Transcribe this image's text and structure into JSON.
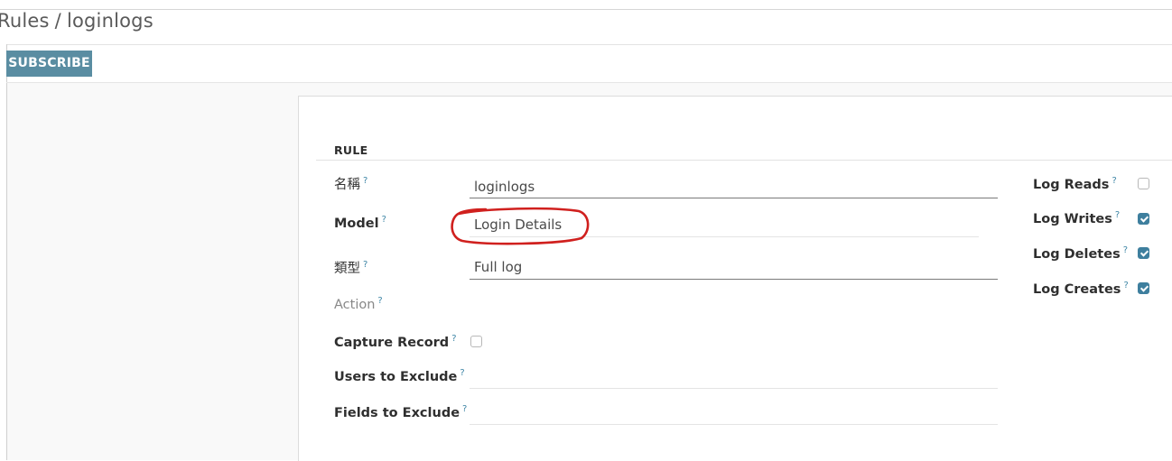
{
  "breadcrumb": {
    "parent": "Rules",
    "separator": "/",
    "current": "loginlogs"
  },
  "toolbar": {
    "subscribe_label": "SUBSCRIBE"
  },
  "form": {
    "group_title": "RULE",
    "help_mark": "?",
    "fields": {
      "name": {
        "label": "名稱",
        "value": "loginlogs"
      },
      "model": {
        "label": "Model",
        "value": "Login Details"
      },
      "type": {
        "label": "類型",
        "value": "Full log"
      },
      "action": {
        "label": "Action"
      },
      "capture_record": {
        "label": "Capture Record",
        "checked": false
      },
      "users_to_exclude": {
        "label": "Users to Exclude",
        "value": ""
      },
      "fields_to_exclude": {
        "label": "Fields to Exclude",
        "value": ""
      }
    },
    "log_options": [
      {
        "label": "Log Reads",
        "checked": false
      },
      {
        "label": "Log Writes",
        "checked": true
      },
      {
        "label": "Log Deletes",
        "checked": true
      },
      {
        "label": "Log Creates",
        "checked": true
      }
    ]
  },
  "colors": {
    "accent": "#5a8da2",
    "checkbox_checked": "#3e7f9e",
    "help_mark": "#3f86a6",
    "annotation": "#d0201e"
  }
}
